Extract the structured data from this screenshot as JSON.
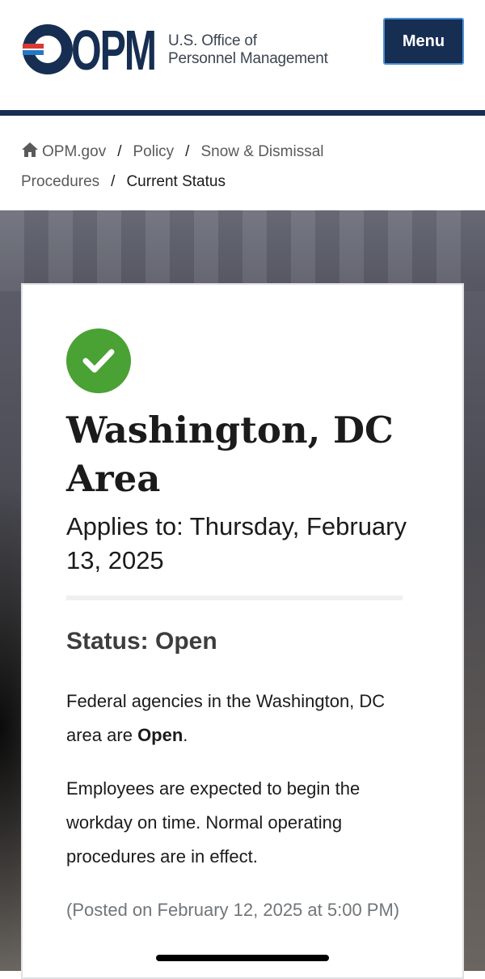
{
  "header": {
    "logo_text": "OPM",
    "agency_line1": "U.S. Office of",
    "agency_line2": "Personnel Management",
    "menu_label": "Menu"
  },
  "breadcrumb": {
    "items": [
      "OPM.gov",
      "Policy",
      "Snow & Dismissal Procedures"
    ],
    "current": "Current Status",
    "separator": "/"
  },
  "status_card": {
    "icon": "checkmark-circle-icon",
    "icon_color": "#4aa134",
    "title": "Washington, DC Area",
    "applies_to": "Applies to: Thursday, February 13, 2025",
    "status_heading": "Status: Open",
    "para1_prefix": "Federal agencies in the Washington, DC area are ",
    "para1_bold": "Open",
    "para1_suffix": ".",
    "para2": "Employees are expected to begin the workday on time. Normal operating procedures are in effect.",
    "posted": "(Posted on February 12, 2025 at 5:00 PM)"
  },
  "colors": {
    "navy": "#162e51",
    "brand_red": "#d83933",
    "brand_blue": "#2378c3",
    "success_green": "#4aa134"
  }
}
